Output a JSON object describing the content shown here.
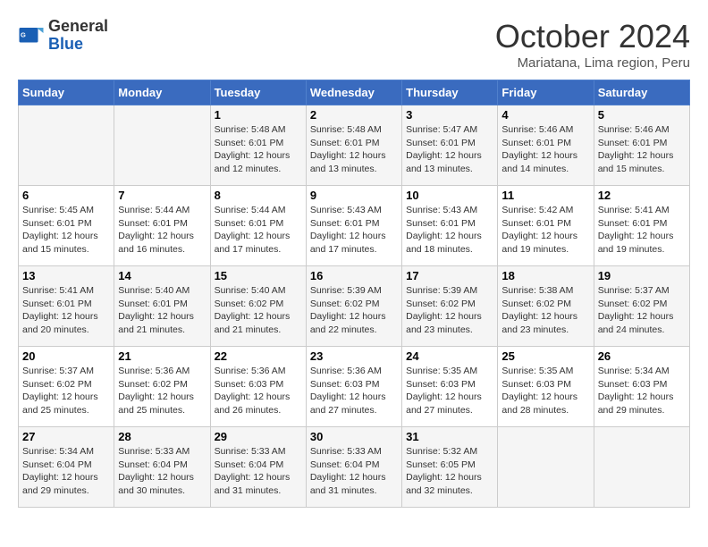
{
  "header": {
    "logo_line1": "General",
    "logo_line2": "Blue",
    "month": "October 2024",
    "location": "Mariatana, Lima region, Peru"
  },
  "weekdays": [
    "Sunday",
    "Monday",
    "Tuesday",
    "Wednesday",
    "Thursday",
    "Friday",
    "Saturday"
  ],
  "weeks": [
    [
      {
        "day": "",
        "info": ""
      },
      {
        "day": "",
        "info": ""
      },
      {
        "day": "1",
        "info": "Sunrise: 5:48 AM\nSunset: 6:01 PM\nDaylight: 12 hours and 12 minutes."
      },
      {
        "day": "2",
        "info": "Sunrise: 5:48 AM\nSunset: 6:01 PM\nDaylight: 12 hours and 13 minutes."
      },
      {
        "day": "3",
        "info": "Sunrise: 5:47 AM\nSunset: 6:01 PM\nDaylight: 12 hours and 13 minutes."
      },
      {
        "day": "4",
        "info": "Sunrise: 5:46 AM\nSunset: 6:01 PM\nDaylight: 12 hours and 14 minutes."
      },
      {
        "day": "5",
        "info": "Sunrise: 5:46 AM\nSunset: 6:01 PM\nDaylight: 12 hours and 15 minutes."
      }
    ],
    [
      {
        "day": "6",
        "info": "Sunrise: 5:45 AM\nSunset: 6:01 PM\nDaylight: 12 hours and 15 minutes."
      },
      {
        "day": "7",
        "info": "Sunrise: 5:44 AM\nSunset: 6:01 PM\nDaylight: 12 hours and 16 minutes."
      },
      {
        "day": "8",
        "info": "Sunrise: 5:44 AM\nSunset: 6:01 PM\nDaylight: 12 hours and 17 minutes."
      },
      {
        "day": "9",
        "info": "Sunrise: 5:43 AM\nSunset: 6:01 PM\nDaylight: 12 hours and 17 minutes."
      },
      {
        "day": "10",
        "info": "Sunrise: 5:43 AM\nSunset: 6:01 PM\nDaylight: 12 hours and 18 minutes."
      },
      {
        "day": "11",
        "info": "Sunrise: 5:42 AM\nSunset: 6:01 PM\nDaylight: 12 hours and 19 minutes."
      },
      {
        "day": "12",
        "info": "Sunrise: 5:41 AM\nSunset: 6:01 PM\nDaylight: 12 hours and 19 minutes."
      }
    ],
    [
      {
        "day": "13",
        "info": "Sunrise: 5:41 AM\nSunset: 6:01 PM\nDaylight: 12 hours and 20 minutes."
      },
      {
        "day": "14",
        "info": "Sunrise: 5:40 AM\nSunset: 6:01 PM\nDaylight: 12 hours and 21 minutes."
      },
      {
        "day": "15",
        "info": "Sunrise: 5:40 AM\nSunset: 6:02 PM\nDaylight: 12 hours and 21 minutes."
      },
      {
        "day": "16",
        "info": "Sunrise: 5:39 AM\nSunset: 6:02 PM\nDaylight: 12 hours and 22 minutes."
      },
      {
        "day": "17",
        "info": "Sunrise: 5:39 AM\nSunset: 6:02 PM\nDaylight: 12 hours and 23 minutes."
      },
      {
        "day": "18",
        "info": "Sunrise: 5:38 AM\nSunset: 6:02 PM\nDaylight: 12 hours and 23 minutes."
      },
      {
        "day": "19",
        "info": "Sunrise: 5:37 AM\nSunset: 6:02 PM\nDaylight: 12 hours and 24 minutes."
      }
    ],
    [
      {
        "day": "20",
        "info": "Sunrise: 5:37 AM\nSunset: 6:02 PM\nDaylight: 12 hours and 25 minutes."
      },
      {
        "day": "21",
        "info": "Sunrise: 5:36 AM\nSunset: 6:02 PM\nDaylight: 12 hours and 25 minutes."
      },
      {
        "day": "22",
        "info": "Sunrise: 5:36 AM\nSunset: 6:03 PM\nDaylight: 12 hours and 26 minutes."
      },
      {
        "day": "23",
        "info": "Sunrise: 5:36 AM\nSunset: 6:03 PM\nDaylight: 12 hours and 27 minutes."
      },
      {
        "day": "24",
        "info": "Sunrise: 5:35 AM\nSunset: 6:03 PM\nDaylight: 12 hours and 27 minutes."
      },
      {
        "day": "25",
        "info": "Sunrise: 5:35 AM\nSunset: 6:03 PM\nDaylight: 12 hours and 28 minutes."
      },
      {
        "day": "26",
        "info": "Sunrise: 5:34 AM\nSunset: 6:03 PM\nDaylight: 12 hours and 29 minutes."
      }
    ],
    [
      {
        "day": "27",
        "info": "Sunrise: 5:34 AM\nSunset: 6:04 PM\nDaylight: 12 hours and 29 minutes."
      },
      {
        "day": "28",
        "info": "Sunrise: 5:33 AM\nSunset: 6:04 PM\nDaylight: 12 hours and 30 minutes."
      },
      {
        "day": "29",
        "info": "Sunrise: 5:33 AM\nSunset: 6:04 PM\nDaylight: 12 hours and 31 minutes."
      },
      {
        "day": "30",
        "info": "Sunrise: 5:33 AM\nSunset: 6:04 PM\nDaylight: 12 hours and 31 minutes."
      },
      {
        "day": "31",
        "info": "Sunrise: 5:32 AM\nSunset: 6:05 PM\nDaylight: 12 hours and 32 minutes."
      },
      {
        "day": "",
        "info": ""
      },
      {
        "day": "",
        "info": ""
      }
    ]
  ]
}
